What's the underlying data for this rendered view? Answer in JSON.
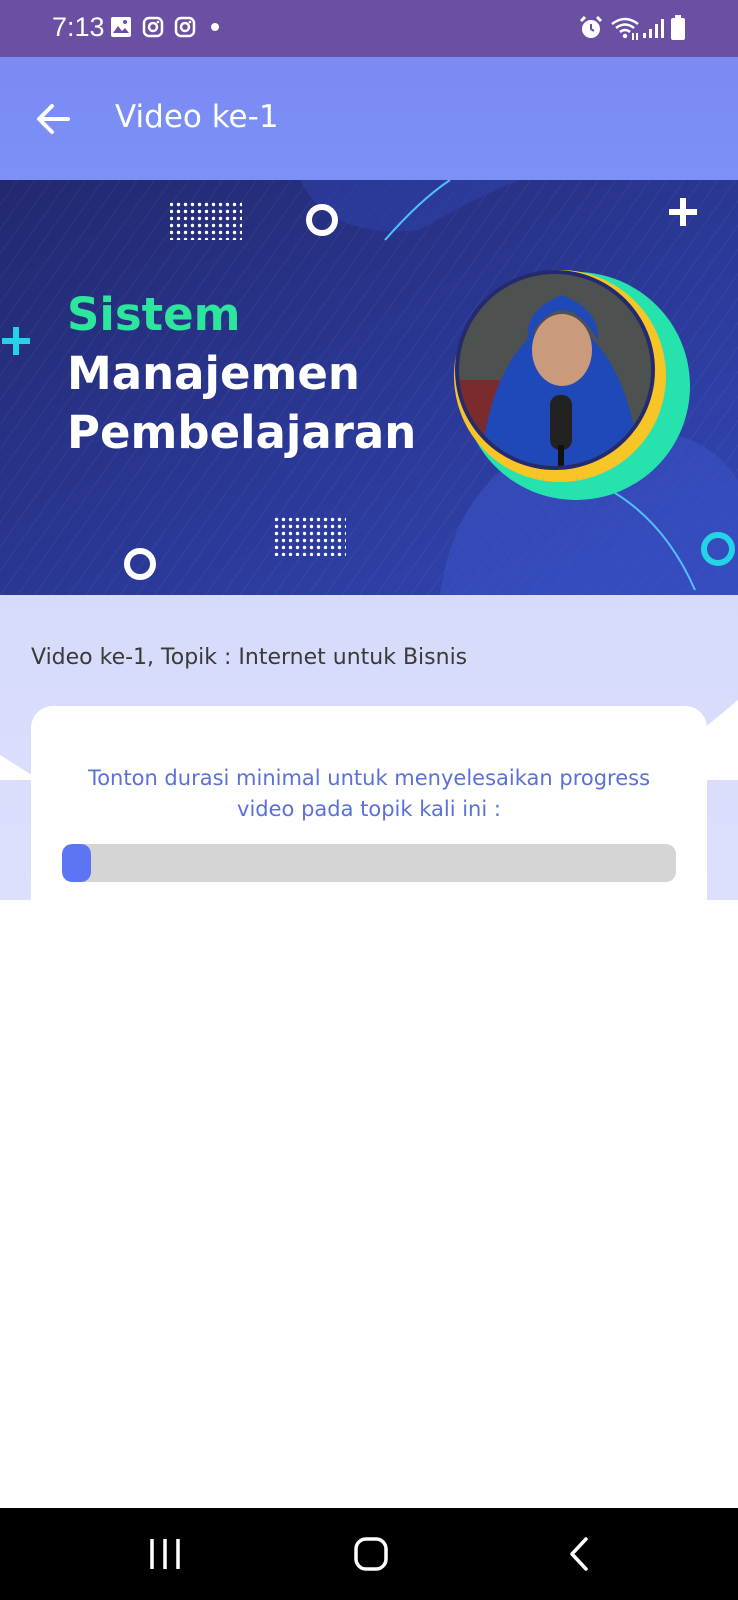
{
  "status_bar": {
    "time": "7:13",
    "left_icons": [
      "gallery-icon",
      "instagram-icon",
      "instagram-icon",
      "dot-icon"
    ],
    "right_icons": [
      "alarm-icon",
      "wifi-icon",
      "signal-icon",
      "battery-icon"
    ]
  },
  "app_bar": {
    "title": "Video ke-1",
    "back_icon": "arrow-left-icon"
  },
  "banner": {
    "title_line1": "Sistem",
    "title_line2": "Manajemen",
    "title_line3": "Pembelajaran"
  },
  "topic": {
    "label": "Video ke-1, Topik : Internet untuk Bisnis"
  },
  "card": {
    "notice": "Tonton durasi minimal untuk menyelesaikan progress video pada topik kali ini :",
    "progress_fraction": 0.047
  },
  "colors": {
    "status_bar": "#6a4fa3",
    "app_bar": "#7a8bf4",
    "banner_bg": "#2e2e86",
    "accent_green": "#2ee59d",
    "progress_fill": "#5d75f5",
    "progress_track": "#d5d5d5",
    "notice_text": "#5b70d8"
  },
  "nav_bar": {
    "icons": [
      "recent-apps-icon",
      "home-icon",
      "back-icon"
    ]
  }
}
